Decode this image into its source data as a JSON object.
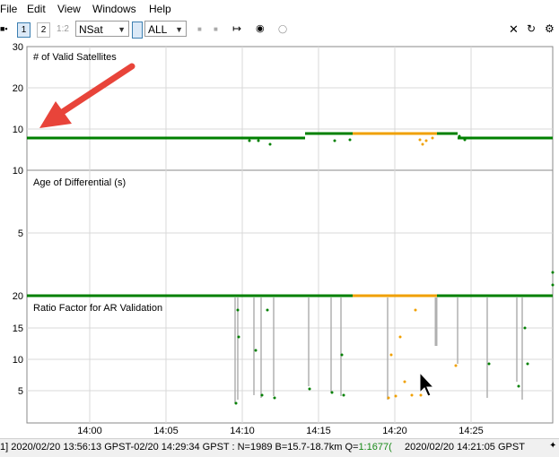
{
  "menu": {
    "file": "File",
    "edit": "Edit",
    "view": "View",
    "windows": "Windows",
    "help": "Help"
  },
  "toolbar": {
    "frame1": "1",
    "frame2": "2",
    "frame12": "1:2",
    "plot_type": "NSat",
    "satellite_filter": "ALL",
    "icons": [
      "fit-range-icon",
      "center-icon",
      "point-icon",
      "close-icon",
      "refresh-icon",
      "options-icon"
    ]
  },
  "panels": [
    {
      "title": "# of Valid Satellites",
      "ticks": [
        "30",
        "20",
        "10"
      ]
    },
    {
      "title": "Age of Differential (s)",
      "ticks": [
        "10",
        "5"
      ]
    },
    {
      "title": "Ratio Factor for AR Validation",
      "ticks": [
        "20",
        "15",
        "10",
        "5"
      ]
    }
  ],
  "x_ticks": [
    "14:00",
    "14:05",
    "14:10",
    "14:15",
    "14:20",
    "14:25"
  ],
  "colors": {
    "fix": "#008000",
    "float": "#f0a000",
    "gap": "#b0b0b0",
    "accent": "#e8443a"
  },
  "chart_data": {
    "type": "scatter",
    "x_unit": "time (GPST)",
    "series": [
      {
        "panel": "# of Valid Satellites",
        "fix_level": 9,
        "float_level": 9
      },
      {
        "panel": "Ratio Factor for AR Validation",
        "fix_level": 20,
        "float_level": 20
      }
    ]
  },
  "status": {
    "left_prefix": "1] 2020/02/20 13:56:13 GPST-02/20 14:29:34 GPST : N=1989 B=15.7-18.7km Q=",
    "left_q": "1:1677(",
    "right": "2020/02/20 14:21:05 GPST"
  }
}
